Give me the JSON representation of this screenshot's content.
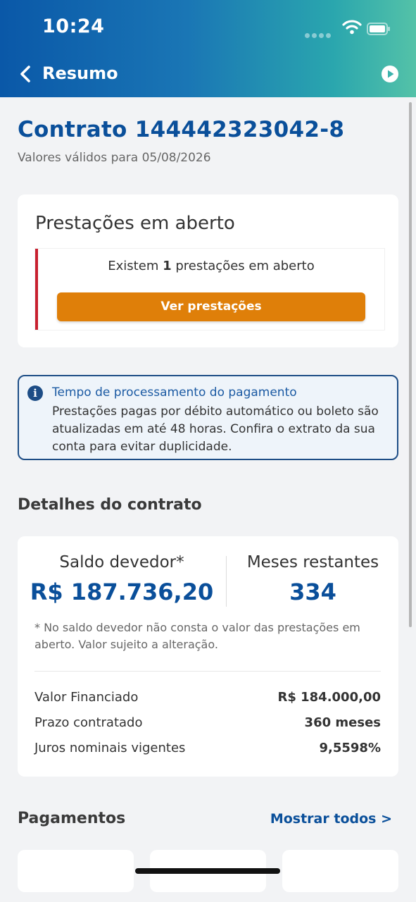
{
  "status_bar": {
    "time": "10:24"
  },
  "nav": {
    "title": "Resumo"
  },
  "contract": {
    "title": "Contrato 144442323042-8",
    "valid_text": "Valores válidos para 05/08/2026"
  },
  "open_installments": {
    "title": "Prestações em aberto",
    "text_prefix": "Existem ",
    "count": "1",
    "text_suffix": " prestações em aberto",
    "button_label": "Ver prestações"
  },
  "info": {
    "title": "Tempo de processamento do pagamento",
    "body": "Prestações pagas por débito automático ou boleto são atualizadas em até 48 horas. Confira o extrato da sua conta para evitar duplicidade."
  },
  "details": {
    "section_title": "Detalhes do contrato",
    "balance_label": "Saldo devedor*",
    "balance_value": "R$ 187.736,20",
    "months_label": "Meses restantes",
    "months_value": "334",
    "footnote": "* No saldo devedor não consta o valor das prestações em aberto. Valor sujeito a alteração.",
    "rows": [
      {
        "label": "Valor Financiado",
        "value": "R$ 184.000,00"
      },
      {
        "label": "Prazo contratado",
        "value": "360 meses"
      },
      {
        "label": "Juros nominais vigentes",
        "value": "9,5598%"
      }
    ]
  },
  "payments": {
    "title": "Pagamentos",
    "show_all": "Mostrar todos >"
  },
  "colors": {
    "primary": "#0a4f9a",
    "accent_orange": "#df7f09",
    "alert_red": "#c8202f",
    "info_border": "#1d4d86"
  },
  "icons": [
    "back-chevron-icon",
    "play-icon",
    "wifi-icon",
    "battery-icon",
    "info-icon"
  ]
}
